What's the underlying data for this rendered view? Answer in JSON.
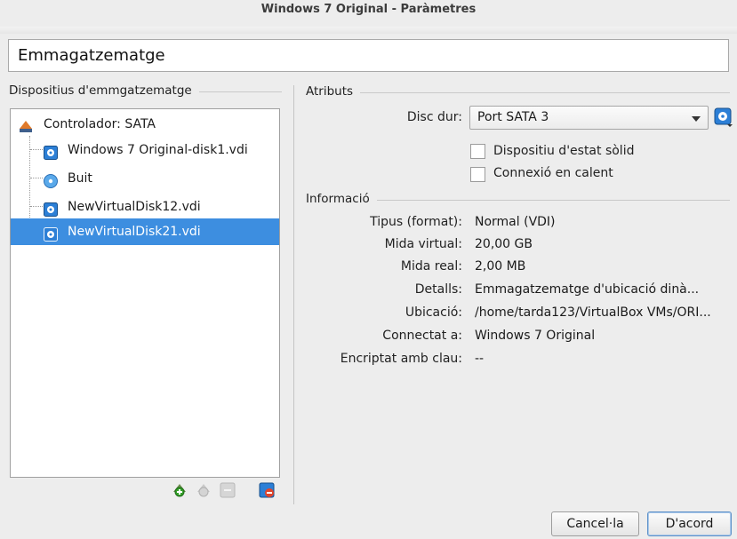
{
  "window": {
    "title": "Windows 7 Original - Paràmetres"
  },
  "header": {
    "title": "Emmagatzematge"
  },
  "storage": {
    "group_title": "Dispositius d'emmgatzematge",
    "items": [
      {
        "label": "Controlador: SATA",
        "icon": "sata-controller-icon",
        "selected": false
      },
      {
        "label": "Windows 7 Original-disk1.vdi",
        "icon": "hard-disk-icon",
        "selected": false
      },
      {
        "label": "Buit",
        "icon": "optical-disc-icon",
        "selected": false
      },
      {
        "label": "NewVirtualDisk12.vdi",
        "icon": "hard-disk-icon",
        "selected": false
      },
      {
        "label": "NewVirtualDisk21.vdi",
        "icon": "hard-disk-icon",
        "selected": true
      }
    ],
    "toolbar": [
      "add-controller-icon",
      "remove-controller-icon",
      "add-attachment-icon",
      "remove-attachment-icon"
    ]
  },
  "attributes": {
    "group_title": "Atributs",
    "disk_label": "Disc dur:",
    "disk_value": "Port SATA 3",
    "ssd_label": "Dispositiu d'estat sòlid",
    "ssd_checked": false,
    "hotplug_label": "Connexió en calent",
    "hotplug_checked": false
  },
  "information": {
    "group_title": "Informació",
    "rows": [
      {
        "label": "Tipus (format):",
        "value": "Normal (VDI)"
      },
      {
        "label": "Mida virtual:",
        "value": "20,00 GB"
      },
      {
        "label": "Mida real:",
        "value": "2,00 MB"
      },
      {
        "label": "Detalls:",
        "value": "Emmagatzematge d'ubicació dinà..."
      },
      {
        "label": "Ubicació:",
        "value": "/home/tarda123/VirtualBox VMs/ORI..."
      },
      {
        "label": "Connectat a:",
        "value": "Windows 7 Original"
      },
      {
        "label": "Encriptat amb clau:",
        "value": "--"
      }
    ]
  },
  "buttons": {
    "cancel": "Cancel·la",
    "ok": "D'acord"
  },
  "colors": {
    "selection": "#3d8ee0",
    "accent": "#2f7fd0"
  }
}
